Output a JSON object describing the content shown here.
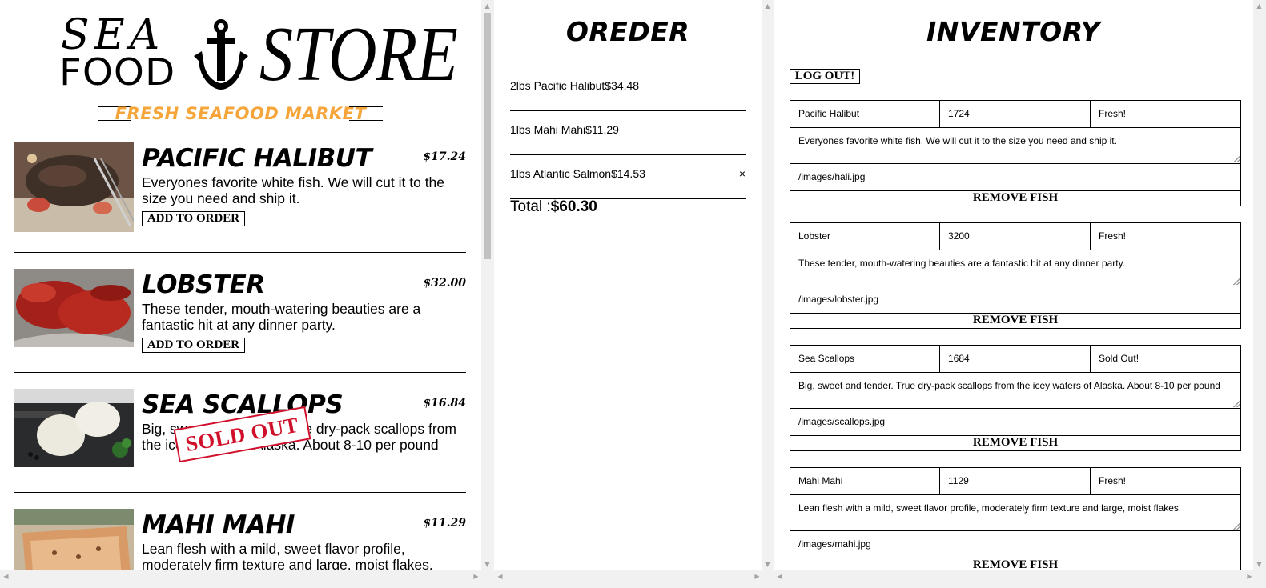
{
  "menu": {
    "logo": {
      "sea": "SEA",
      "food": "FOOD",
      "store": "STORE"
    },
    "tagline": "FRESH SEAFOOD MARKET",
    "add_label": "ADD TO ORDER",
    "sold_out_label": "SOLD OUT",
    "fishes": [
      {
        "name": "PACIFIC HALIBUT",
        "price": "$17.24",
        "desc": "Everyones favorite white fish. We will cut it to the size you need and ship it.",
        "status": "available"
      },
      {
        "name": "LOBSTER",
        "price": "$32.00",
        "desc": "These tender, mouth-watering beauties are a fantastic hit at any dinner party.",
        "status": "available"
      },
      {
        "name": "SEA SCALLOPS",
        "price": "$16.84",
        "desc": "Big, sweet and tender. True dry-pack scallops from the icey waters of Alaska. About 8-10 per pound",
        "status": "sold-out"
      },
      {
        "name": "MAHI MAHI",
        "price": "$11.29",
        "desc": "Lean flesh with a mild, sweet flavor profile, moderately firm texture and large, moist flakes.",
        "status": "available"
      }
    ]
  },
  "order": {
    "title": "OREDER",
    "items": [
      {
        "text": "2lbs Pacific Halibut$34.48"
      },
      {
        "text": "1lbs Mahi Mahi$11.29"
      },
      {
        "text": "1lbs Atlantic Salmon$14.53",
        "remove": "×"
      }
    ],
    "total_label": "Total :",
    "total_value": "$60.30"
  },
  "inventory": {
    "title": "INVENTORY",
    "logout_label": "LOG OUT!",
    "remove_label": "REMOVE FISH",
    "items": [
      {
        "name": "Pacific Halibut",
        "price": "1724",
        "status": "Fresh!",
        "desc": "Everyones favorite white fish. We will cut it to the size you need and ship it.",
        "image": "/images/hali.jpg"
      },
      {
        "name": "Lobster",
        "price": "3200",
        "status": "Fresh!",
        "desc": "These tender, mouth-watering beauties are a fantastic hit at any dinner party.",
        "image": "/images/lobster.jpg"
      },
      {
        "name": "Sea Scallops",
        "price": "1684",
        "status": "Sold Out!",
        "desc": "Big, sweet and tender. True dry-pack scallops from the icey waters of Alaska. About 8-10 per pound",
        "image": "/images/scallops.jpg"
      },
      {
        "name": "Mahi Mahi",
        "price": "1129",
        "status": "Fresh!",
        "desc": "Lean flesh with a mild, sweet flavor profile, moderately firm texture and large, moist flakes.",
        "image": "/images/mahi.jpg"
      }
    ]
  },
  "colors": {
    "tagline": "#f5a53a",
    "sold_out": "#d0102b"
  }
}
